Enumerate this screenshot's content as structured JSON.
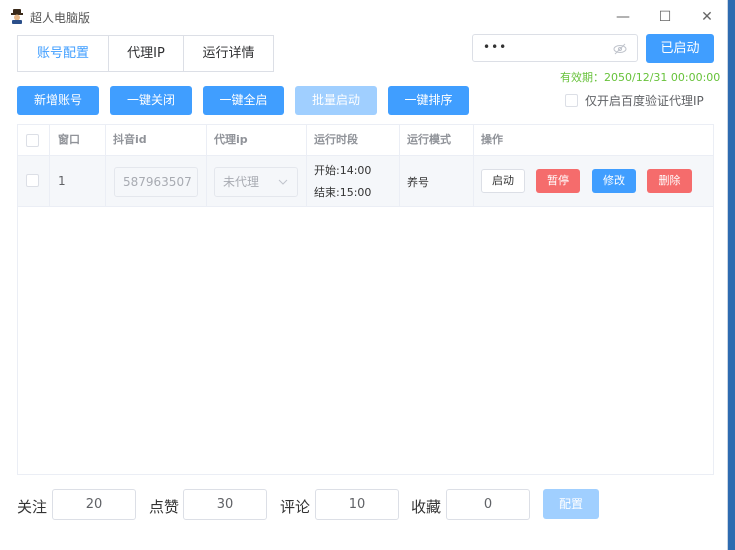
{
  "window": {
    "title": "超人电脑版",
    "minimize": "—",
    "maximize": "☐",
    "close": "✕"
  },
  "tabs": [
    {
      "label": "账号配置",
      "active": true
    },
    {
      "label": "代理IP",
      "active": false
    },
    {
      "label": "运行详情",
      "active": false
    }
  ],
  "auth": {
    "password_value": "•••",
    "start_label": "已启动",
    "validity": "有效期：2050/12/31 00:00:00"
  },
  "toolbar": {
    "add_label": "新增账号",
    "close_all_label": "一键关闭",
    "start_all_label": "一键全启",
    "batch_start_label": "批量启动",
    "sort_label": "一键排序",
    "baidu_proxy_label": "仅开启百度验证代理IP"
  },
  "table": {
    "headers": [
      "窗口",
      "抖音id",
      "代理ip",
      "运行时段",
      "运行模式",
      "操作"
    ],
    "rows": [
      {
        "window": "1",
        "douyin_id": "587963507",
        "proxy": "未代理",
        "start_time": "开始:14:00",
        "end_time": "结束:15:00",
        "mode": "养号",
        "actions": {
          "start": "启动",
          "pause": "暂停",
          "edit": "修改",
          "delete": "删除"
        }
      }
    ]
  },
  "footer": {
    "follow_label": "关注",
    "follow_value": "20",
    "like_label": "点赞",
    "like_value": "30",
    "comment_label": "评论",
    "comment_value": "10",
    "favorite_label": "收藏",
    "favorite_value": "0",
    "config_label": "配置"
  },
  "colors": {
    "primary": "#409eff",
    "disabled": "#a0cfff",
    "danger": "#f56c6c",
    "success": "#67c23a"
  },
  "icons": {
    "app": "hat-person-icon",
    "eye": "eye-off-icon",
    "dropdown": "chevron-down-icon"
  }
}
